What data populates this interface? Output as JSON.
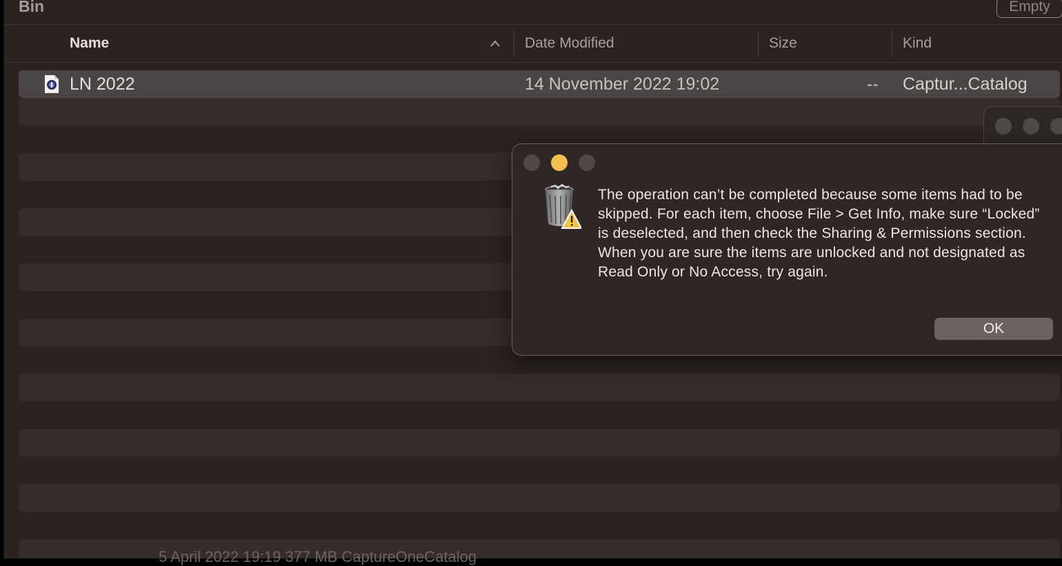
{
  "window": {
    "title": "Bin",
    "empty_button": "Empty"
  },
  "columns": {
    "name": "Name",
    "date": "Date Modified",
    "size": "Size",
    "kind": "Kind"
  },
  "files": [
    {
      "name": "LN 2022",
      "date": "14 November 2022 19:02",
      "size": "--",
      "kind": "Captur...Catalog",
      "icon": "capture-one-catalog-icon"
    }
  ],
  "partial_row": {
    "text": "5 April 2022 19:19          377 MB     CaptureOneCatalog"
  },
  "dialog": {
    "message": "The operation can’t be completed because some items had to be skipped. For each item, choose File > Get Info, make sure “Locked” is deselected, and then check the Sharing & Permissions section. When you are sure the items are unlocked and not designated as Read Only or No Access, try again.",
    "ok_label": "OK",
    "icon": "trash-warning-icon"
  },
  "colors": {
    "window_bg": "#2a2320",
    "selected_row": "#4b4645",
    "minimize": "#f4bf4f"
  }
}
